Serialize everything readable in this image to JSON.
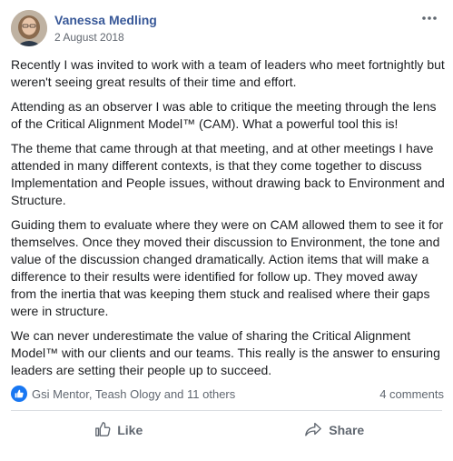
{
  "post": {
    "author": "Vanessa Medling",
    "date": "2 August 2018",
    "paragraphs": [
      "Recently I was invited to work with a team of leaders who meet fortnightly but weren't seeing great results of their time and effort.",
      "Attending as an observer I was able to critique the meeting through the lens of the Critical Alignment Model™ (CAM). What a powerful tool this is!",
      "The theme that came through at that meeting, and at other meetings I have attended in many different contexts, is that they come together to discuss Implementation and People issues, without drawing back to Environment and Structure.",
      "Guiding them to evaluate where they were on CAM allowed them to see it for themselves. Once they moved their discussion to Environment, the tone and value of the discussion changed dramatically. Action items that will make a difference to their results were identified for follow up. They moved away from the inertia that was keeping them stuck and realised where their gaps were in structure.",
      "We can never underestimate the value of sharing the Critical Alignment Model™ with our clients and our teams. This really is the answer to ensuring leaders are setting their people up to succeed."
    ]
  },
  "stats": {
    "reactors": "Gsi Mentor, Teash Ology and 11 others",
    "comments": "4 comments"
  },
  "actions": {
    "like": "Like",
    "share": "Share"
  },
  "icons": {
    "like_badge_color": "#1877f2",
    "more": "more-options-icon",
    "like": "thumbs-up-icon",
    "share": "share-arrow-icon"
  }
}
